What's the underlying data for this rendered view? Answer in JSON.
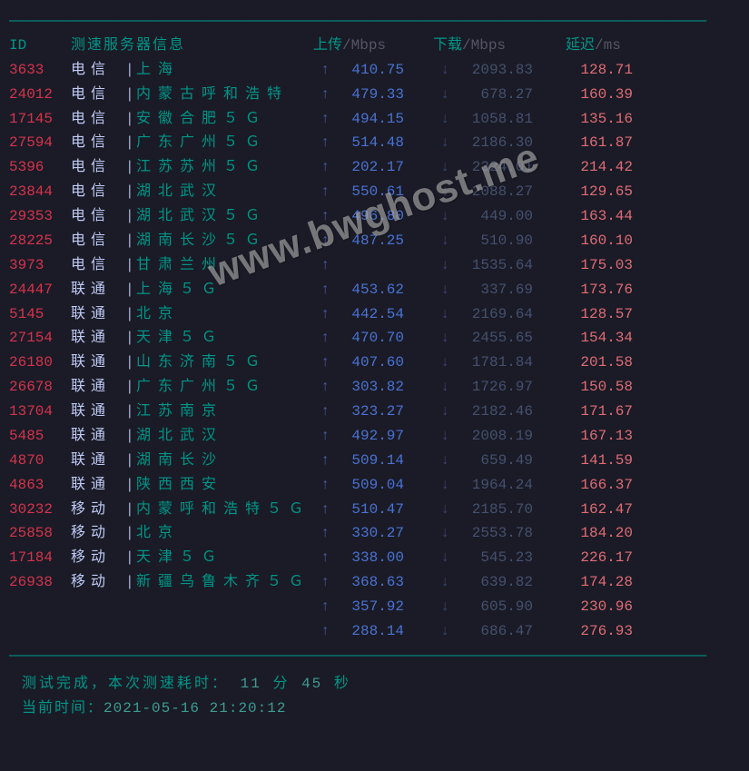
{
  "header": {
    "id": "ID",
    "info": "测速服务器信息",
    "up_lbl": "上传",
    "up_unit": "/Mbps",
    "dn_lbl": "下载",
    "dn_unit": "/Mbps",
    "lat_lbl": "延迟",
    "lat_unit": "/ms"
  },
  "rows": [
    {
      "id": "3633",
      "isp": "电信",
      "loc": "上海",
      "up": "410.75",
      "dn": "2093.83",
      "lat": "128.71"
    },
    {
      "id": "24012",
      "isp": "电信",
      "loc": "内蒙古呼和浩特",
      "up": "479.33",
      "dn": "678.27",
      "lat": "160.39"
    },
    {
      "id": "17145",
      "isp": "电信",
      "loc": "安徽合肥５Ｇ",
      "up": "494.15",
      "dn": "1058.81",
      "lat": "135.16"
    },
    {
      "id": "27594",
      "isp": "电信",
      "loc": "广东广州５Ｇ",
      "up": "514.48",
      "dn": "2186.30",
      "lat": "161.87"
    },
    {
      "id": "5396",
      "isp": "电信",
      "loc": "江苏苏州５Ｇ",
      "up": "202.17",
      "dn": "2324.01",
      "lat": "214.42"
    },
    {
      "id": "23844",
      "isp": "电信",
      "loc": "湖北武汉",
      "up": "550.61",
      "dn": "2088.27",
      "lat": "129.65"
    },
    {
      "id": "29353",
      "isp": "电信",
      "loc": "湖北武汉５Ｇ",
      "up": "496.80",
      "dn": "449.00",
      "lat": "163.44"
    },
    {
      "id": "28225",
      "isp": "电信",
      "loc": "湖南长沙５Ｇ",
      "up": "487.25",
      "dn": "510.90",
      "lat": "160.10"
    },
    {
      "id": "3973",
      "isp": "电信",
      "loc": "甘肃兰州",
      "up": " ",
      "dn": "1535.64",
      "lat": "175.03"
    },
    {
      "id": "24447",
      "isp": "联通",
      "loc": "上海５Ｇ",
      "up": "453.62",
      "dn": "337.69",
      "lat": "173.76"
    },
    {
      "id": "5145",
      "isp": "联通",
      "loc": "北京",
      "up": "442.54",
      "dn": "2169.64",
      "lat": "128.57"
    },
    {
      "id": "27154",
      "isp": "联通",
      "loc": "天津５Ｇ",
      "up": "470.70",
      "dn": "2455.65",
      "lat": "154.34"
    },
    {
      "id": "26180",
      "isp": "联通",
      "loc": "山东济南５Ｇ",
      "up": "407.60",
      "dn": "1781.84",
      "lat": "201.58"
    },
    {
      "id": "26678",
      "isp": "联通",
      "loc": "广东广州５Ｇ",
      "up": "303.82",
      "dn": "1726.97",
      "lat": "150.58"
    },
    {
      "id": "13704",
      "isp": "联通",
      "loc": "江苏南京",
      "up": "323.27",
      "dn": "2182.46",
      "lat": "171.67"
    },
    {
      "id": "5485",
      "isp": "联通",
      "loc": "湖北武汉",
      "up": "492.97",
      "dn": "2008.19",
      "lat": "167.13"
    },
    {
      "id": "4870",
      "isp": "联通",
      "loc": "湖南长沙",
      "up": "509.14",
      "dn": "659.49",
      "lat": "141.59"
    },
    {
      "id": "4863",
      "isp": "联通",
      "loc": "陕西西安",
      "up": "509.04",
      "dn": "1964.24",
      "lat": "166.37"
    },
    {
      "id": "30232",
      "isp": "移动",
      "loc": "内蒙呼和浩特５Ｇ",
      "up": "510.47",
      "dn": "2185.70",
      "lat": "162.47"
    },
    {
      "id": "25858",
      "isp": "移动",
      "loc": "北京",
      "up": "330.27",
      "dn": "2553.78",
      "lat": "184.20"
    },
    {
      "id": "17184",
      "isp": "移动",
      "loc": "天津５Ｇ",
      "up": "338.00",
      "dn": "545.23",
      "lat": "226.17"
    },
    {
      "id": "26938",
      "isp": "移动",
      "loc": "新疆乌鲁木齐５Ｇ",
      "up": "368.63",
      "dn": "639.82",
      "lat": "174.28"
    },
    {
      "id": "",
      "isp": "",
      "loc": "",
      "up": "357.92",
      "dn": "605.90",
      "lat": "230.96"
    },
    {
      "id": "",
      "isp": "",
      "loc": "",
      "up": "288.14",
      "dn": "686.47",
      "lat": "276.93"
    }
  ],
  "footer": {
    "done_lbl": "测试完成，本次测速耗时：",
    "min_val": "11",
    "min_lbl": "分",
    "sec_val": "45",
    "sec_lbl": "秒",
    "time_lbl": "当前时间：",
    "time_val": "2021-05-16 21:20:12"
  },
  "watermark": "www.bwghost.me",
  "arrows": {
    "up": "↑",
    "dn": "↓"
  }
}
